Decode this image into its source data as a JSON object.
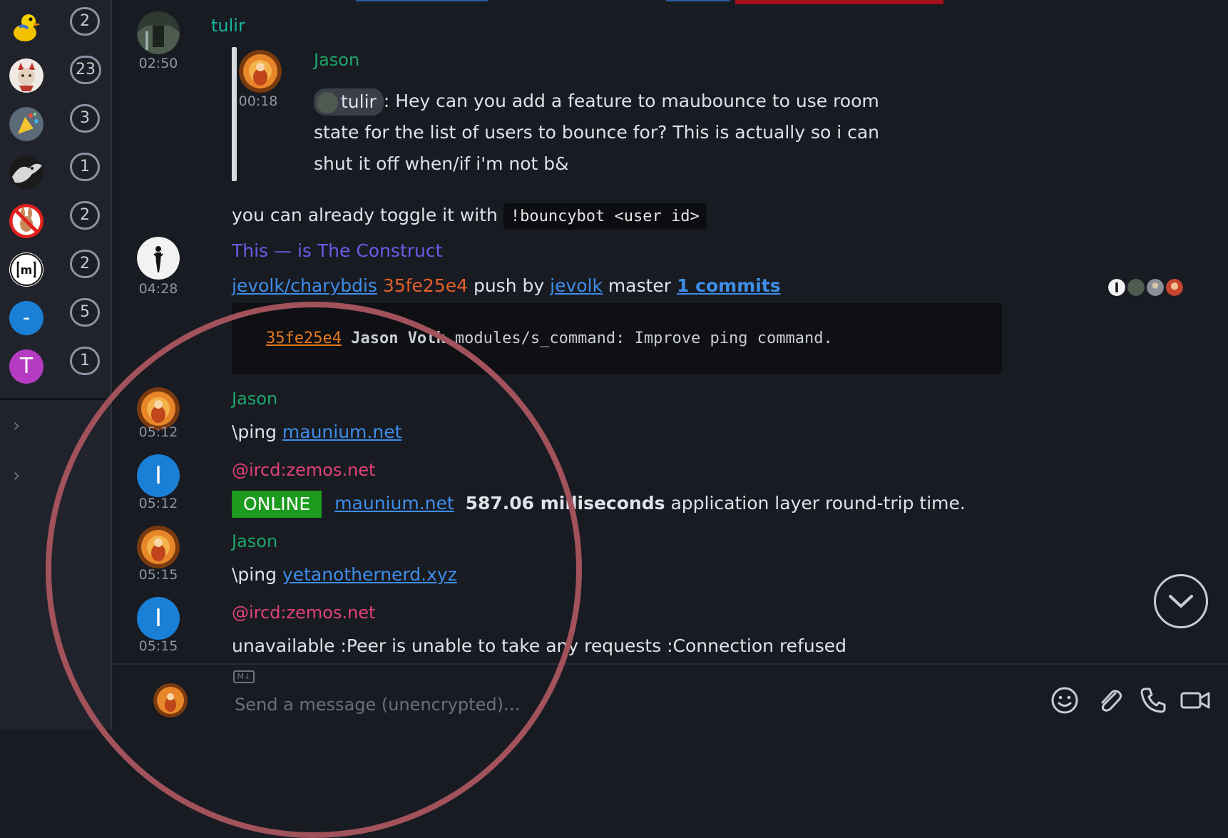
{
  "sidebar": {
    "rooms": [
      {
        "badge": "2",
        "avatar": "duck-avatar"
      },
      {
        "badge": "23",
        "avatar": "cat-avatar"
      },
      {
        "badge": "3",
        "avatar": "party-avatar"
      },
      {
        "badge": "1",
        "avatar": "eagle-avatar"
      },
      {
        "badge": "2",
        "avatar": "no-rabbit-avatar"
      },
      {
        "badge": "2",
        "avatar": "matrix-avatar",
        "letter": "m"
      },
      {
        "badge": "5",
        "avatar": "dash-avatar",
        "letter": "-"
      },
      {
        "badge": "1",
        "avatar": "t-avatar",
        "letter": "T"
      }
    ],
    "colors": {
      "dash": "#1a7fd6",
      "t": "#b53cc2"
    }
  },
  "messages": {
    "m1": {
      "sender": "tulir",
      "time": "02:50"
    },
    "reply": {
      "sender": "Jason",
      "time": "00:18",
      "mention": "tulir",
      "line1": ": Hey can you add a feature to maubounce to use room",
      "line2": "state for the list of users to bounce for? This is actually so i can",
      "line3": "shut it off when/if i'm not b&"
    },
    "m1_text": "you can already toggle it with",
    "m1_code": "!bouncybot <user id>",
    "m2": {
      "time": "04:28",
      "emote": "This — is The Construct",
      "repo": "jevolk/charybdis",
      "hash": "35fe25e4",
      "push_by": "push by",
      "author": "jevolk",
      "branch": "master",
      "commits": "1 commits",
      "code_hash": "35fe25e4",
      "code_author": "Jason Volk",
      "code_msg": "modules/s_command: Improve ping command."
    },
    "m3": {
      "sender": "Jason",
      "time": "05:12",
      "cmd": "\\ping",
      "link": "maunium.net"
    },
    "m4": {
      "sender": "@ircd:zemos.net",
      "time": "05:12",
      "avatar_letter": "I",
      "status": "ONLINE",
      "link": "maunium.net",
      "ms": "587.06 milliseconds",
      "rest": "application layer round-trip time."
    },
    "m5": {
      "sender": "Jason",
      "time": "05:15",
      "cmd": "\\ping",
      "link": "yetanothernerd.xyz"
    },
    "m6": {
      "sender": "@ircd:zemos.net",
      "time": "05:15",
      "avatar_letter": "I",
      "text": "unavailable :Peer is unable to take any requests :Connection refused"
    }
  },
  "composer": {
    "md": "M↓",
    "placeholder": "Send a message (unencrypted)…"
  },
  "colors": {
    "tulir": "#19b6a0",
    "jason": "#1ea66a",
    "construct": "#6b5ce8",
    "ircd": "#e0417a",
    "link": "#3f8ee8",
    "hash": "#e35e2a",
    "online": "#1c9b1e",
    "annotation": "#a1525b"
  }
}
